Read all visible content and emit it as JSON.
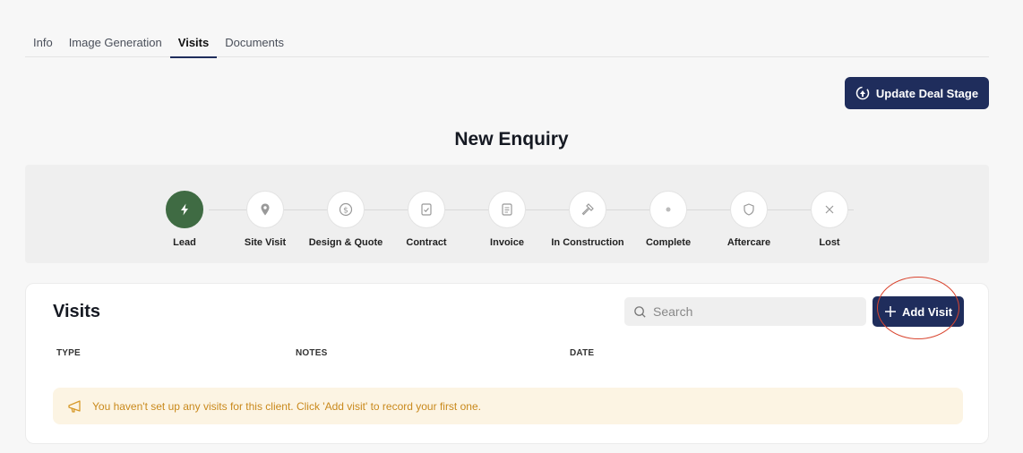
{
  "tabs": [
    {
      "label": "Info",
      "active": false
    },
    {
      "label": "Image Generation",
      "active": false
    },
    {
      "label": "Visits",
      "active": true
    },
    {
      "label": "Documents",
      "active": false
    }
  ],
  "header": {
    "update_stage_label": "Update Deal Stage",
    "stage_title": "New Enquiry"
  },
  "pipeline": {
    "stages": [
      {
        "label": "Lead",
        "icon": "bolt-icon",
        "active": true
      },
      {
        "label": "Site Visit",
        "icon": "map-pin-icon",
        "active": false
      },
      {
        "label": "Design & Quote",
        "icon": "dollar-circle-icon",
        "active": false
      },
      {
        "label": "Contract",
        "icon": "contract-check-icon",
        "active": false
      },
      {
        "label": "Invoice",
        "icon": "invoice-icon",
        "active": false
      },
      {
        "label": "In Construction",
        "icon": "hammer-icon",
        "active": false
      },
      {
        "label": "Complete",
        "icon": "dot-icon",
        "active": false
      },
      {
        "label": "Aftercare",
        "icon": "shield-icon",
        "active": false
      },
      {
        "label": "Lost",
        "icon": "x-icon",
        "active": false
      }
    ]
  },
  "visits": {
    "title": "Visits",
    "search_placeholder": "Search",
    "add_label": "Add Visit",
    "columns": [
      "TYPE",
      "NOTES",
      "DATE"
    ],
    "empty_message": "You haven't set up any visits for this client. Click 'Add visit' to record your first one."
  },
  "colors": {
    "primary": "#1f2d5c",
    "active_stage": "#3f6b43",
    "empty_bg": "#fcf4e3",
    "empty_text": "#c9891c",
    "highlight_ring": "#d9452f"
  }
}
